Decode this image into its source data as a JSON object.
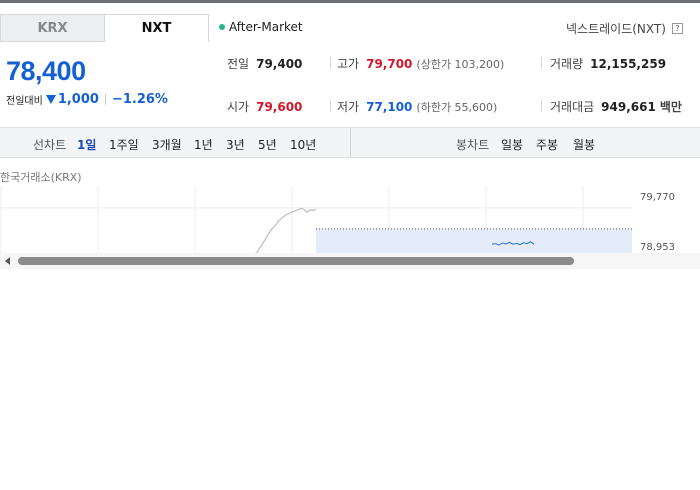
{
  "market_tabs": [
    {
      "label": "KRX",
      "active": false
    },
    {
      "label": "NXT",
      "active": true
    }
  ],
  "session": {
    "label": "After-Market",
    "dot_color": "#25b58a"
  },
  "provider": {
    "label": "넥스트레이드(NXT)",
    "help_glyph": "?"
  },
  "quote": {
    "price": "78,400",
    "change_label": "전일대비",
    "change_amount": "1,000",
    "change_percent": "−1.26%",
    "direction": "down",
    "color": "#1560d4"
  },
  "info": {
    "prev_close": {
      "label": "전일",
      "value": "79,400"
    },
    "high": {
      "label": "고가",
      "value": "79,700",
      "sub": "(상한가 103,200)"
    },
    "volume": {
      "label": "거래량",
      "value": "12,155,259"
    },
    "open": {
      "label": "시가",
      "value": "79,600"
    },
    "low": {
      "label": "저가",
      "value": "77,100",
      "sub": "(하한가 55,600)"
    },
    "amount": {
      "label": "거래대금",
      "value": "949,661",
      "unit": "백만"
    }
  },
  "period_bar": {
    "line_label": "선차트",
    "line_options": [
      "1일",
      "1주일",
      "3개월",
      "1년",
      "3년",
      "5년",
      "10년"
    ],
    "selected": "1일",
    "candle_label": "봉차트",
    "candle_options": [
      "일봉",
      "주봉",
      "월봉"
    ]
  },
  "chart_market_label": "한국거래소(KRX)",
  "chart_data": {
    "type": "line",
    "y_tick_labels": [
      "79,770",
      "78,953"
    ],
    "y_ticks": [
      79770,
      78953
    ],
    "ylim": [
      78700,
      79900
    ],
    "grid": true,
    "series": [
      {
        "values": [
          78720,
          78780,
          78850,
          78900,
          78980,
          79050,
          79120,
          79200,
          79280,
          79350,
          79400,
          79450,
          79520,
          79560,
          79600,
          79640,
          79660,
          79680,
          79700,
          79720,
          79740,
          79760,
          79770,
          79750,
          79700,
          79720,
          79750,
          79730,
          79760
        ]
      },
      {
        "values": [
          78953,
          78960,
          78940,
          78970,
          78955,
          78980,
          78950,
          78965,
          78945,
          78975,
          78960,
          78990,
          78950
        ]
      }
    ],
    "reference_value": 79600
  },
  "colors": {
    "up": "#d3172b",
    "down": "#1560d4",
    "accent": "#1a49b8"
  }
}
